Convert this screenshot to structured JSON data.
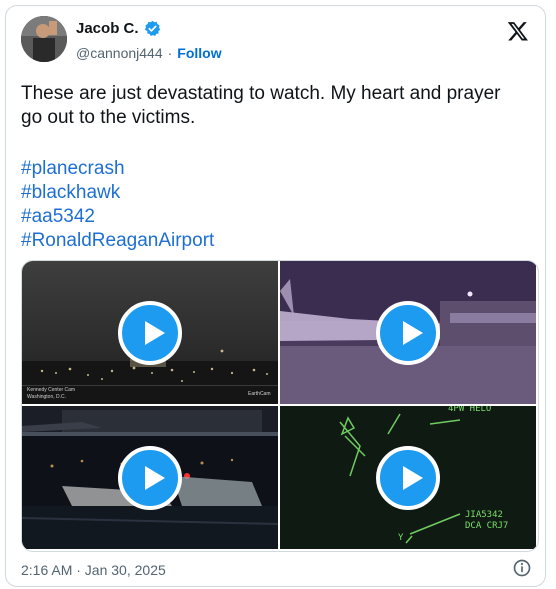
{
  "author": {
    "name": "Jacob C.",
    "handle": "@cannonj444",
    "separator": "·",
    "follow_label": "Follow"
  },
  "tweet": {
    "text": "These are just devastating to watch. My heart and prayer\ngo out to the victims.",
    "hashtags": [
      "#planecrash",
      "#blackhawk",
      "#aa5342",
      "#RonaldReaganAirport"
    ]
  },
  "media": {
    "tile1": {
      "watermark_left": "Kennedy Center Cam",
      "watermark_sub": "Washington, D.C.",
      "watermark_right": "EarthCam"
    },
    "tile4": {
      "radar_line1": "JIA5342",
      "radar_line2": "DCA CRJ7",
      "radar_top": "4PW  HELO",
      "radar_letter": "Y"
    }
  },
  "timestamp": "2:16 AM · Jan 30, 2025",
  "colors": {
    "link": "#1d6fd4",
    "play": "#1d9bf0",
    "muted": "#536471"
  },
  "icons": {
    "verified": "verified-badge-icon",
    "x": "x-logo-icon",
    "info": "info-icon",
    "play": "play-icon"
  }
}
